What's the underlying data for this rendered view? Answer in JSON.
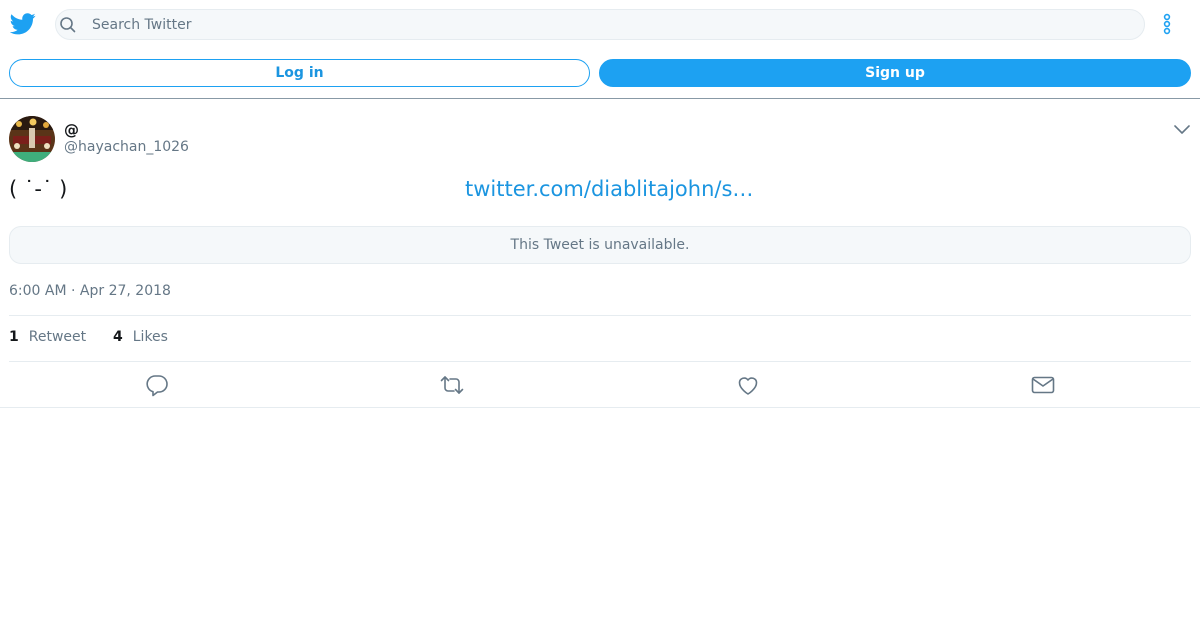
{
  "header": {
    "logo_icon": "twitter-bird-icon",
    "search_placeholder": "Search Twitter",
    "more_icon": "more-vertical-icon",
    "accent_color": "#1da1f2"
  },
  "auth": {
    "login_label": "Log in",
    "signup_label": "Sign up"
  },
  "tweet": {
    "display_name": "@",
    "handle": "@hayachan_1026",
    "text": "( ˙-˙ )",
    "link": "twitter.com/diablitajohn/s…",
    "quoted_notice": "This Tweet is unavailable.",
    "timestamp": "6:00 AM · Apr 27, 2018",
    "stats": {
      "retweet_count": "1",
      "retweet_label": "Retweet",
      "like_count": "4",
      "like_label": "Likes"
    }
  },
  "actions": [
    {
      "name": "reply",
      "icon": "reply-icon"
    },
    {
      "name": "retweet",
      "icon": "retweet-icon"
    },
    {
      "name": "like",
      "icon": "heart-icon"
    },
    {
      "name": "share",
      "icon": "mail-icon"
    }
  ]
}
